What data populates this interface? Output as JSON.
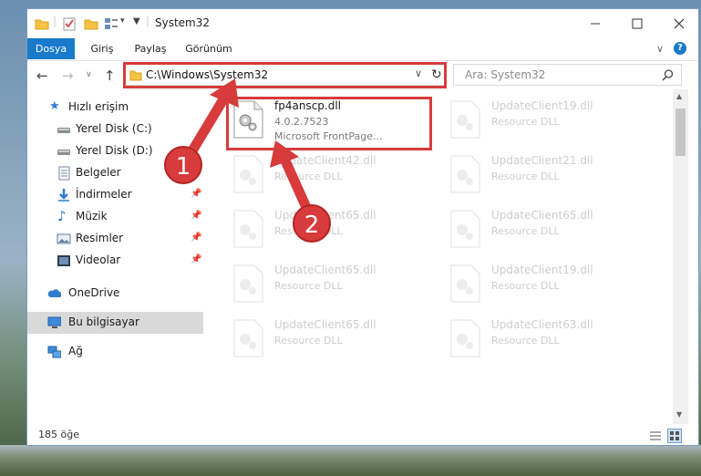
{
  "window": {
    "title": "System32",
    "controls": {
      "minimize": "minimize-icon",
      "maximize": "maximize-icon",
      "close": "close-icon"
    }
  },
  "ribbon": {
    "tabs": [
      {
        "label": "Dosya"
      },
      {
        "label": "Giriş"
      },
      {
        "label": "Paylaş"
      },
      {
        "label": "Görünüm"
      }
    ]
  },
  "navbar": {
    "address": "C:\\Windows\\System32",
    "search_placeholder": "Ara: System32"
  },
  "sidebar": {
    "items": [
      {
        "label": "Hızlı erişim",
        "icon": "star-icon"
      },
      {
        "label": "Yerel Disk (C:)",
        "icon": "drive-icon"
      },
      {
        "label": "Yerel Disk (D:)",
        "icon": "drive-icon"
      },
      {
        "label": "Belgeler",
        "icon": "documents-icon"
      },
      {
        "label": "İndirmeler",
        "icon": "download-icon"
      },
      {
        "label": "Müzik",
        "icon": "music-icon"
      },
      {
        "label": "Resimler",
        "icon": "pictures-icon"
      },
      {
        "label": "Videolar",
        "icon": "video-icon"
      },
      {
        "label": "OneDrive",
        "icon": "cloud-icon"
      },
      {
        "label": "Bu bilgisayar",
        "icon": "computer-icon"
      },
      {
        "label": "Ağ",
        "icon": "network-icon"
      }
    ]
  },
  "files": [
    {
      "name": "fp4anscp.dll",
      "line2": "4.0.2.7523",
      "line3": "Microsoft FrontPage..."
    },
    {
      "name": "UpdateClient19.dll",
      "line2": "Resource DLL"
    },
    {
      "name": "UpdateClient42.dll",
      "line2": "Resource DLL"
    },
    {
      "name": "UpdateClient21.dll",
      "line2": "Resource DLL"
    },
    {
      "name": "UpdateClient65.dll",
      "line2": "Resource DLL"
    },
    {
      "name": "UpdateClient65.dll",
      "line2": "Resource DLL"
    },
    {
      "name": "UpdateClient65.dll",
      "line2": "Resource DLL"
    },
    {
      "name": "UpdateClient19.dll",
      "line2": "Resource DLL"
    },
    {
      "name": "UpdateClient65.dll",
      "line2": "Resource DLL"
    },
    {
      "name": "UpdateClient63.dll",
      "line2": "Resource DLL"
    }
  ],
  "status": {
    "count": "185 öğe"
  },
  "annotations": {
    "step1": "1",
    "step2": "2",
    "color": "#d73b3b"
  }
}
